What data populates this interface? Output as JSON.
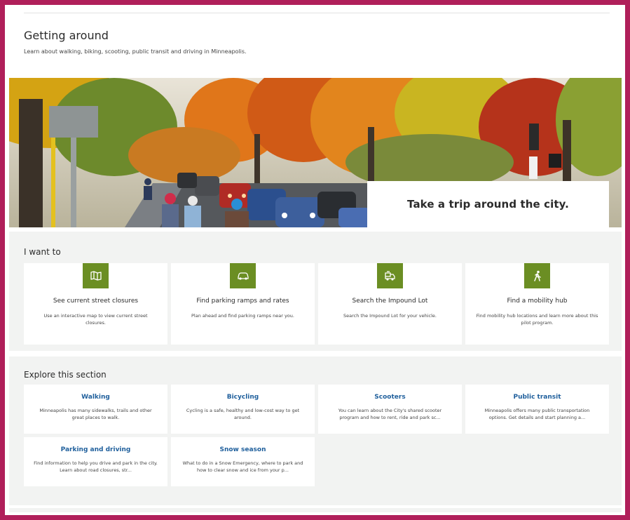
{
  "header": {
    "title": "Getting around",
    "subtitle": "Learn about walking, biking, scooting, public transit and driving in Minneapolis."
  },
  "hero": {
    "tagline": "Take a trip around the city."
  },
  "want": {
    "title": "I want to",
    "cards": [
      {
        "icon": "map-icon",
        "title": "See current street closures",
        "desc": "Use an interactive map to view current street closures."
      },
      {
        "icon": "car-icon",
        "title": "Find parking ramps and rates",
        "desc": "Plan ahead and find parking ramps near you."
      },
      {
        "icon": "tow-truck-icon",
        "title": "Search the Impound Lot",
        "desc": "Search the Impound Lot for your vehicle."
      },
      {
        "icon": "walking-person-icon",
        "title": "Find a mobility hub",
        "desc": "Find mobility hub locations and learn more about this pilot program."
      }
    ]
  },
  "explore": {
    "title": "Explore this section",
    "cards": [
      {
        "title": "Walking",
        "desc": "Minneapolis has many sidewalks, trails and other great places to walk."
      },
      {
        "title": "Bicycling",
        "desc": "Cycling is a safe, healthy and low-cost way to get around."
      },
      {
        "title": "Scooters",
        "desc": "You can learn about the City's shared scooter program and how to rent, ride and park sc..."
      },
      {
        "title": "Public transit",
        "desc": "Minneapolis offers many public transportation options. Get details and start planning a..."
      },
      {
        "title": "Parking and driving",
        "desc": "Find information to help you drive and park in the city. Learn about road closures, str..."
      },
      {
        "title": "Snow season",
        "desc": "What to do in a Snow Emergency, where to park and how to clear snow and ice from your p..."
      }
    ]
  },
  "colors": {
    "frame": "#b01f5a",
    "icon_bg": "#6b8e23",
    "link": "#1f5f9c",
    "section_bg": "#f2f3f2"
  }
}
